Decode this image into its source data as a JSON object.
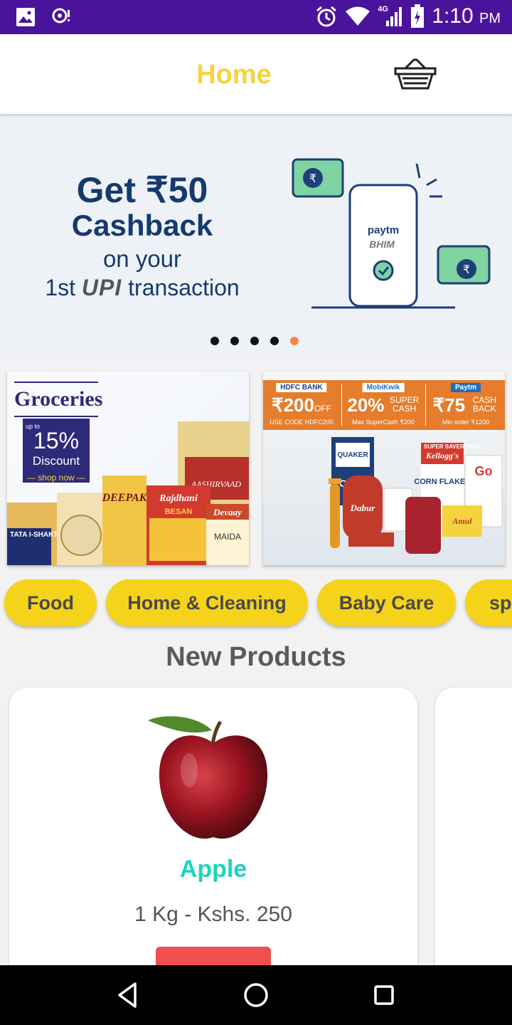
{
  "status_bar": {
    "time": "1:10",
    "ampm": "PM",
    "network": "4G",
    "icons": [
      "image-icon",
      "location-icon",
      "alarm-icon",
      "wifi-icon",
      "signal-icon",
      "battery-icon"
    ],
    "background": "#4a139c"
  },
  "app_bar": {
    "title": "Home",
    "title_color": "#f5d33f",
    "cart_icon": "basket-icon"
  },
  "hero": {
    "line1": "Get ₹50",
    "line2": "Cashback",
    "line3": "on your",
    "line4_pre": "1st",
    "line4_upi": "UPI",
    "line4_post": "transaction",
    "phone_brand": "paytm",
    "phone_sub": "BHIM",
    "rupee": "₹",
    "slide_count": 5,
    "active_slide": 5
  },
  "promos": {
    "left": {
      "title": "Groceries",
      "upto": "up to",
      "percent": "15%",
      "discount": "Discount",
      "shop": "— shop now —",
      "brands": [
        "DEEPAK",
        "Rajdhani",
        "BESAN",
        "Devaay",
        "MAIDA",
        "TATA I-SHAKTI",
        "AASHIRVAAD"
      ]
    },
    "right": {
      "offer1_logo": "HDFC BANK",
      "offer1_main": "₹200",
      "offer1_unit": "OFF",
      "offer1_sub": "USE CODE HDFC200",
      "offer2_logo": "MobiKwik",
      "offer2_main": "20%",
      "offer2_unit": "SUPER CASH",
      "offer2_sub": "Max SuperCash ₹200",
      "offer3_logo": "Paytm",
      "offer3_main": "₹75",
      "offer3_unit": "CASH BACK",
      "offer3_sub": "Min order ₹1200",
      "brands": [
        "QUAKER",
        "OATS",
        "Kellogg's",
        "CORN FLAKES",
        "Go",
        "Dabur",
        "Amul",
        "SUPER SAVER PACK"
      ]
    }
  },
  "categories": [
    {
      "label": "Food"
    },
    {
      "label": "Home & Cleaning"
    },
    {
      "label": "Baby Care"
    },
    {
      "label": "spo"
    }
  ],
  "section_title": "New Products",
  "products": [
    {
      "name": "Apple",
      "price": "1 Kg - Kshs. 250",
      "image": "apple-image"
    }
  ],
  "colors": {
    "chip": "#f5d31a",
    "product_name": "#1bd3c0",
    "add_button": "#ef4f4f",
    "accent_dot": "#f08a4b"
  },
  "nav_bar": {
    "icons": [
      "back-icon",
      "home-icon",
      "recents-icon"
    ]
  }
}
